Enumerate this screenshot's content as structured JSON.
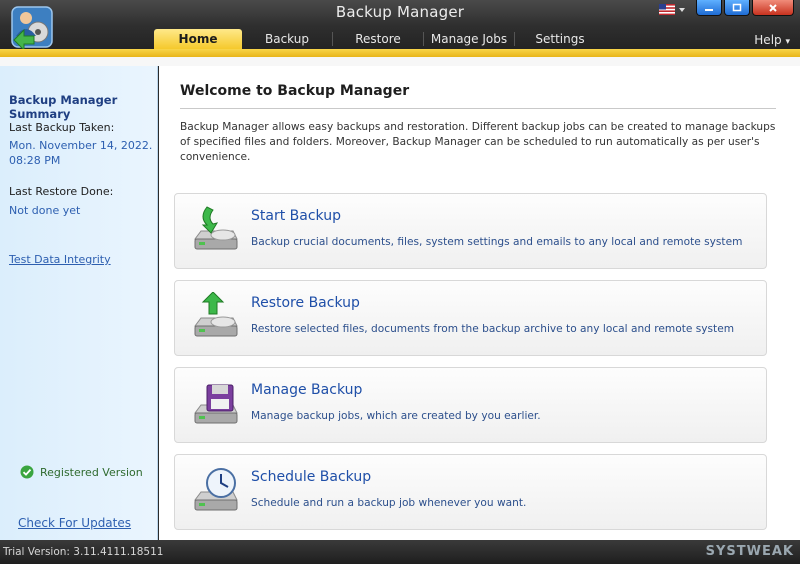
{
  "window": {
    "title": "Backup Manager",
    "help_label": "Help",
    "help_chevron": "▾"
  },
  "tabs": [
    {
      "label": "Home",
      "active": true
    },
    {
      "label": "Backup",
      "active": false
    },
    {
      "label": "Restore",
      "active": false
    },
    {
      "label": "Manage Jobs",
      "active": false
    },
    {
      "label": "Settings",
      "active": false
    }
  ],
  "sidebar": {
    "summary_title": "Backup Manager Summary",
    "last_backup_label": "Last Backup Taken:",
    "last_backup_value_line1": "Mon. November 14, 2022.",
    "last_backup_value_line2": "08:28 PM",
    "last_restore_label": "Last Restore Done:",
    "last_restore_value": "Not done yet",
    "test_link": "Test Data Integrity",
    "registered_label": "Registered Version",
    "check_updates_label": "Check For Updates"
  },
  "main": {
    "title": "Welcome to Backup Manager",
    "description": "Backup Manager allows easy backups and restoration. Different backup jobs can be created to manage backups of specified files and folders. Moreover, Backup Manager can be scheduled to run automatically as per user's convenience.",
    "cards": [
      {
        "title": "Start Backup",
        "desc": "Backup crucial documents, files, system settings and emails to any local and remote system",
        "icon": "start-backup-icon"
      },
      {
        "title": "Restore Backup",
        "desc": "Restore selected files, documents from the backup archive to any local and remote system",
        "icon": "restore-backup-icon"
      },
      {
        "title": "Manage Backup",
        "desc": "Manage backup jobs, which are created by you earlier.",
        "icon": "manage-backup-icon"
      },
      {
        "title": "Schedule Backup",
        "desc": "Schedule and run a backup job whenever you want.",
        "icon": "schedule-backup-icon"
      }
    ]
  },
  "statusbar": {
    "trial_text": "Trial Version: 3.11.4111.18511",
    "watermark": "SYSTWEAK"
  },
  "colors": {
    "accent_gold": "#f5c92c",
    "link_blue": "#2d5fb0",
    "titlebar": "#2f2f2f"
  }
}
